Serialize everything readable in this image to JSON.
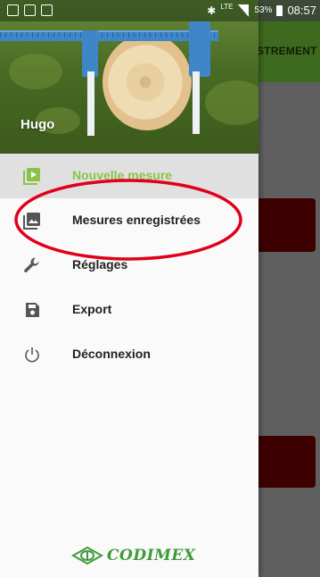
{
  "status_bar": {
    "lte": "LTE",
    "battery": "53%",
    "time": "08:57"
  },
  "app": {
    "toolbar_title_fragment": "STREMENT"
  },
  "drawer": {
    "header": {
      "user_name": "Hugo"
    },
    "menu": [
      {
        "label": "Nouvelle mesure",
        "icon": "play-box-icon",
        "active": true
      },
      {
        "label": "Mesures enregistrées",
        "icon": "photo-gallery-icon",
        "active": false
      },
      {
        "label": "Réglages",
        "icon": "wrench-icon",
        "active": false
      },
      {
        "label": "Export",
        "icon": "save-icon",
        "active": false
      },
      {
        "label": "Déconnexion",
        "icon": "power-icon",
        "active": false
      }
    ],
    "footer_logo": "CODIMEX"
  },
  "colors": {
    "active_green": "#8bc34a",
    "toolbar_green": "#3e6a1f",
    "annotation_red": "#e0001a",
    "logo_green": "#3f9a3a"
  }
}
